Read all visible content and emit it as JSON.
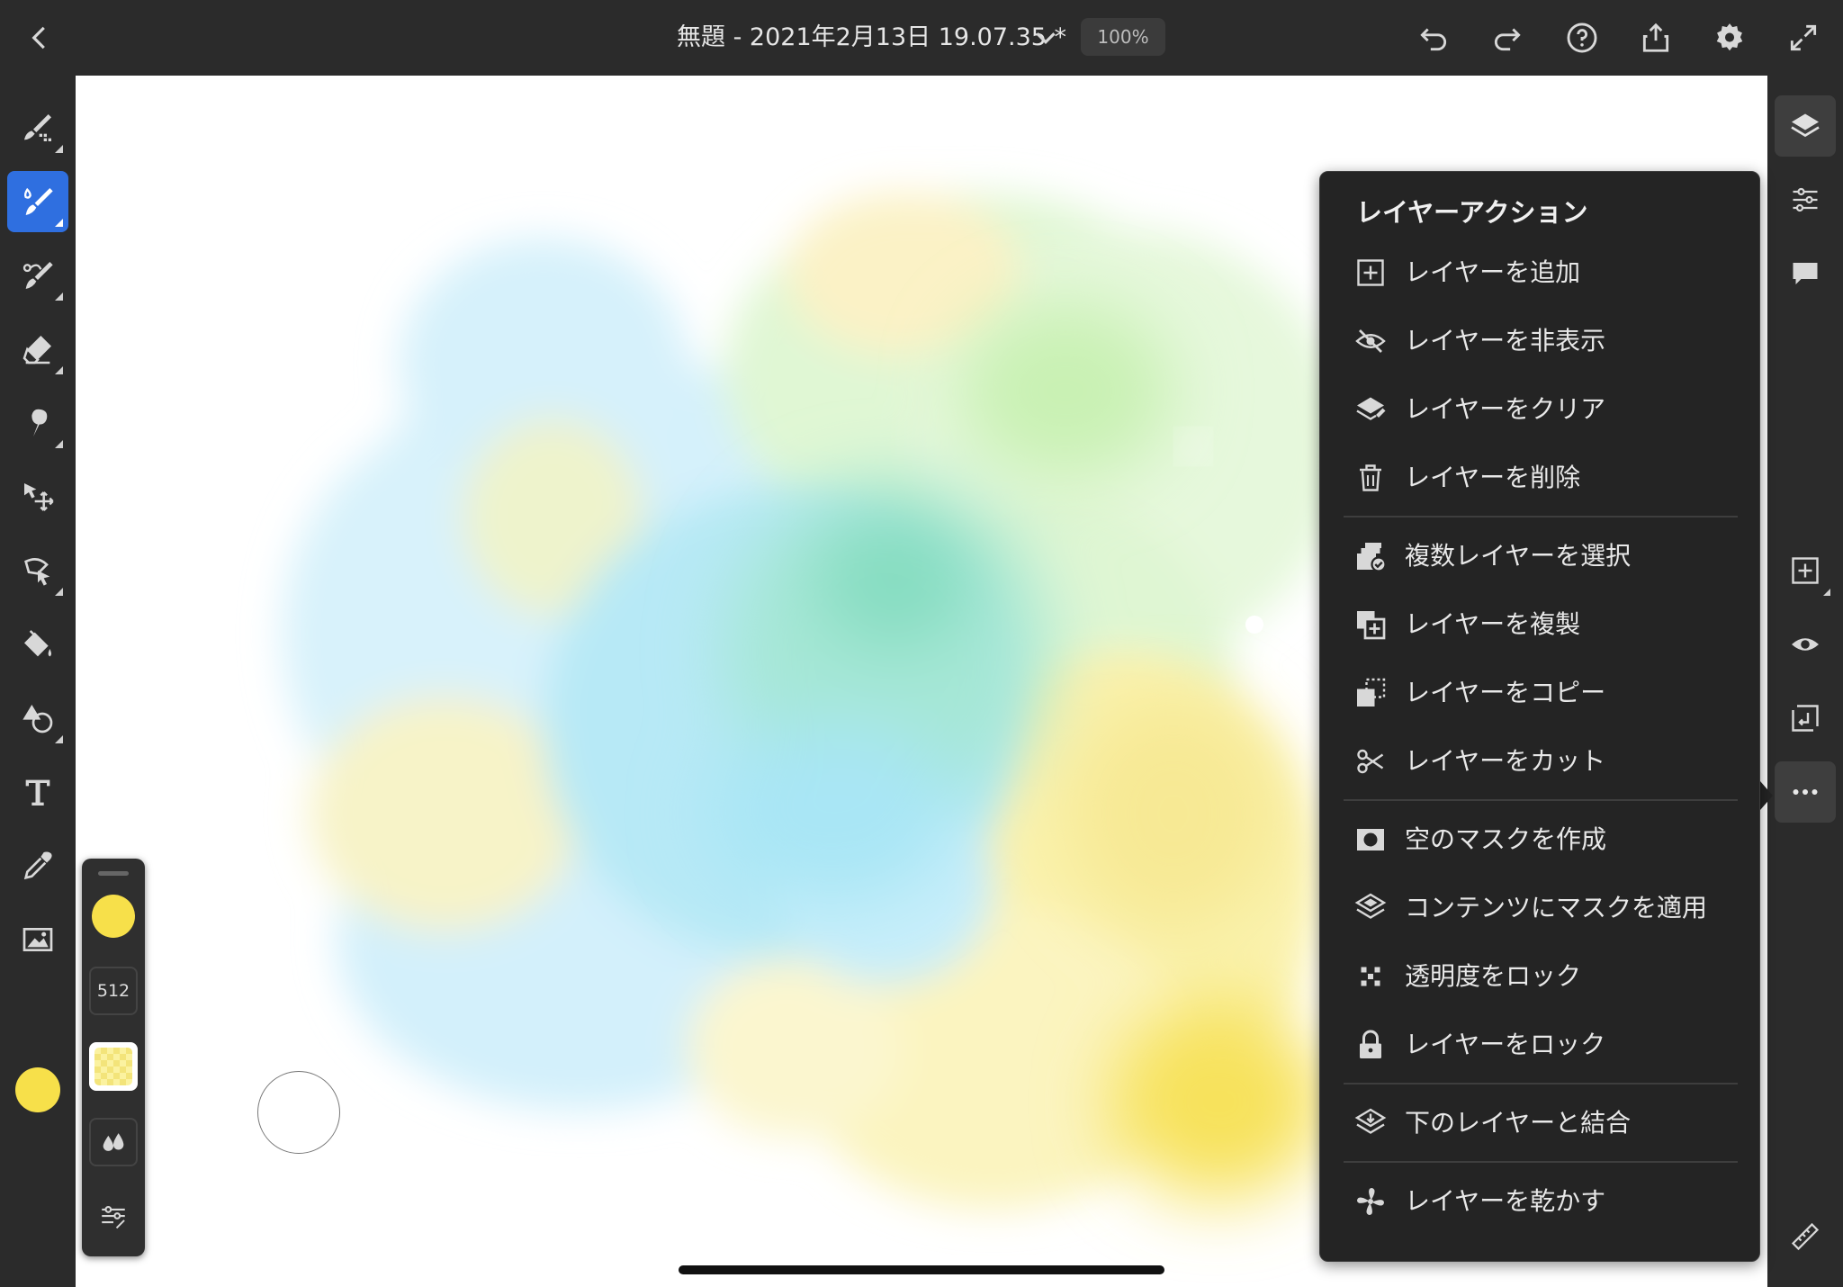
{
  "header": {
    "back_icon": "chevron-left-icon",
    "title": "無題 - 2021年2月13日 19.07.35 *",
    "title_dropdown_icon": "chevron-down-icon",
    "zoom": "100%",
    "actions": [
      "undo-icon",
      "redo-icon",
      "help-icon",
      "share-icon",
      "settings-icon",
      "fullscreen-icon"
    ]
  },
  "left_toolbar": {
    "tools": [
      "pixel-brush-icon",
      "live-brush-icon",
      "vector-brush-icon",
      "eraser-icon",
      "smudge-icon",
      "transform-icon",
      "selection-icon",
      "fill-icon",
      "shapes-icon",
      "text-icon",
      "eyedropper-icon",
      "image-icon"
    ],
    "active_tool": "live-brush-icon",
    "current_color": "#f7e04a"
  },
  "brush_panel": {
    "color": "#f7e04a",
    "size": "512",
    "opacity_icon": "checker-opacity-icon",
    "flow_icon": "drops-icon",
    "settings_icon": "brush-settings-icon"
  },
  "canvas": {
    "background": "#ffffff",
    "paint_colors": [
      "#d4f0fb",
      "#a8e6f5",
      "#7fdcc0",
      "#d6f5c4",
      "#fbf3a8",
      "#f7e04a"
    ]
  },
  "right_panel": {
    "tools": [
      "layers-icon",
      "adjustments-icon",
      "comments-icon",
      "add-layer-icon",
      "visibility-icon",
      "layer-import-icon",
      "more-icon",
      "ruler-icon"
    ]
  },
  "layer_menu": {
    "title": "レイヤーアクション",
    "groups": [
      [
        {
          "icon": "add-layer-icon",
          "label": "レイヤーを追加"
        },
        {
          "icon": "hide-icon",
          "label": "レイヤーを非表示"
        },
        {
          "icon": "clear-layer-icon",
          "label": "レイヤーをクリア"
        },
        {
          "icon": "trash-icon",
          "label": "レイヤーを削除"
        }
      ],
      [
        {
          "icon": "multi-select-icon",
          "label": "複数レイヤーを選択"
        },
        {
          "icon": "duplicate-icon",
          "label": "レイヤーを複製"
        },
        {
          "icon": "copy-icon",
          "label": "レイヤーをコピー"
        },
        {
          "icon": "scissors-icon",
          "label": "レイヤーをカット"
        }
      ],
      [
        {
          "icon": "mask-icon",
          "label": "空のマスクを作成"
        },
        {
          "icon": "apply-mask-icon",
          "label": "コンテンツにマスクを適用"
        },
        {
          "icon": "transparency-lock-icon",
          "label": "透明度をロック"
        },
        {
          "icon": "lock-icon",
          "label": "レイヤーをロック"
        }
      ],
      [
        {
          "icon": "merge-down-icon",
          "label": "下のレイヤーと結合"
        }
      ],
      [
        {
          "icon": "dry-layer-icon",
          "label": "レイヤーを乾かす"
        }
      ]
    ]
  }
}
